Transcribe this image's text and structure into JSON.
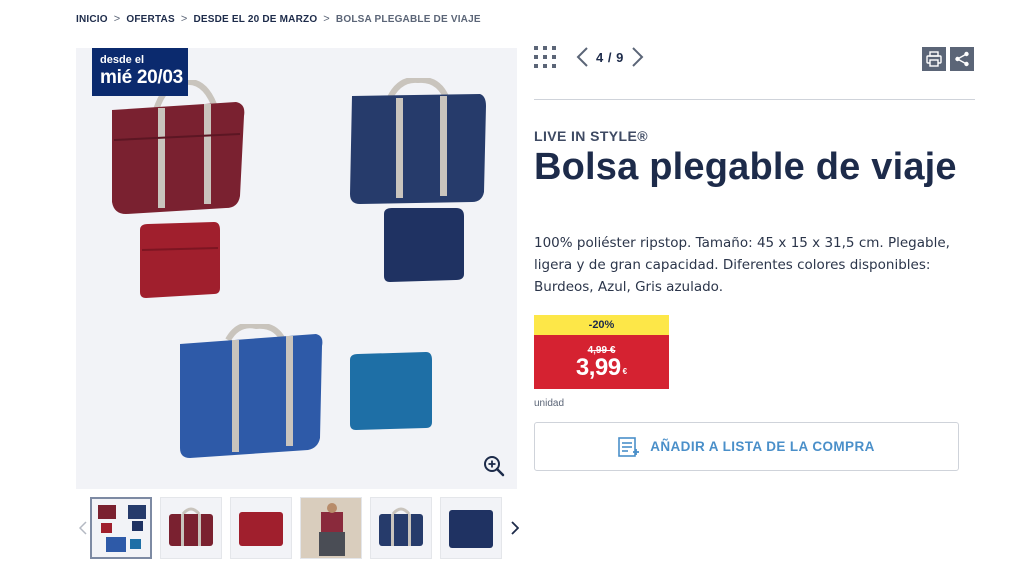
{
  "breadcrumb": {
    "items": [
      "INICIO",
      "OFERTAS",
      "DESDE EL 20 DE MARZO",
      "BOLSA PLEGABLE DE VIAJE"
    ]
  },
  "badge": {
    "line1": "desde el",
    "line2": "mié 20/03"
  },
  "gallery": {
    "counter": "4 / 9"
  },
  "product": {
    "brand": "LIVE IN STYLE®",
    "title": "Bolsa plegable de viaje",
    "description": "100% poliéster ripstop. Tamaño: 45 x 15 x 31,5 cm. Plegable, ligera y de gran capacidad. Diferentes colores disponibles: Burdeos, Azul, Gris azulado."
  },
  "price": {
    "discount": "-20%",
    "old": "4,99 €",
    "current": "3,99",
    "currency": "€",
    "unit": "unidad"
  },
  "actions": {
    "add_to_list": "AÑADIR A LISTA DE LA COMPRA"
  },
  "colors": {
    "navy": "#1d2b4a",
    "badge_blue": "#0b2a6e",
    "discount_yellow": "#fde748",
    "price_red": "#d52231",
    "link_blue": "#4a8fc9"
  },
  "icons": [
    "grid-icon",
    "chevron-left-icon",
    "chevron-right-icon",
    "print-icon",
    "share-icon",
    "zoom-in-icon",
    "shopping-list-icon"
  ]
}
